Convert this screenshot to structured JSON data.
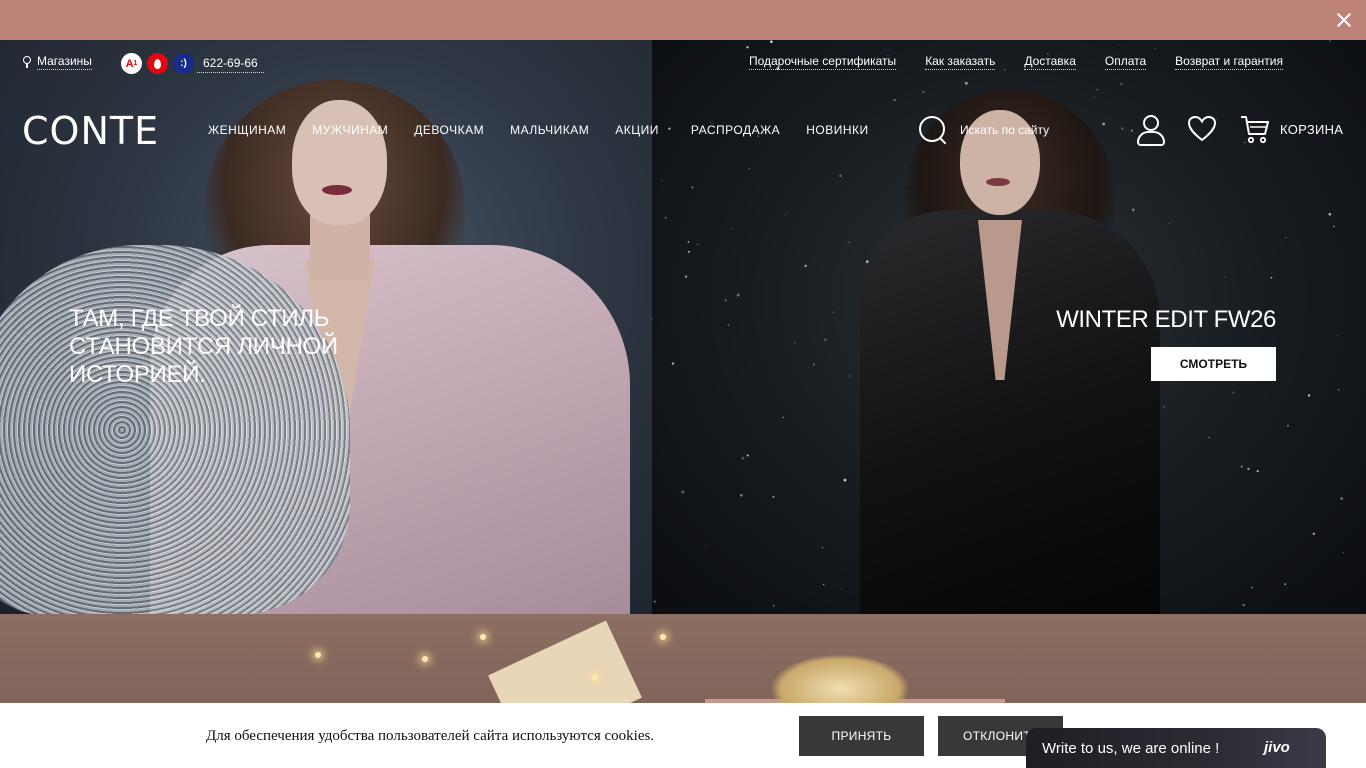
{
  "promo": {
    "close_icon": "close-icon"
  },
  "header": {
    "stores_label": "Магазины",
    "operators": [
      "A1",
      "MTS",
      "life"
    ],
    "phone": "622-69-66",
    "util_links": [
      "Подарочные сертификаты",
      "Как заказать",
      "Доставка",
      "Оплата",
      "Возврат и гарантия"
    ],
    "logo": "CONTE",
    "nav": [
      "ЖЕНЩИНАМ",
      "МУЖЧИНАМ",
      "ДЕВОЧКАМ",
      "МАЛЬЧИКАМ",
      "АКЦИИ",
      "РАСПРОДАЖА",
      "НОВИНКИ"
    ],
    "search_placeholder": "Искать по сайту",
    "cart_label": "КОРЗИНА",
    "icons": [
      "pin-icon",
      "search-icon",
      "user-icon",
      "heart-icon",
      "cart-icon"
    ]
  },
  "hero": {
    "title_lines": [
      "ТАМ, ГДЕ ТВОЙ СТИЛЬ",
      "СТАНОВИТСЯ ЛИЧНОЙ",
      "ИСТОРИЕЙ."
    ],
    "edit_title": "WINTER EDIT FW26",
    "button": "СМОТРЕТЬ"
  },
  "cookie": {
    "text": "Для обеспечения удобства пользователей сайта используются cookies.",
    "accept": "ПРИНЯТЬ",
    "decline": "ОТКЛОНИТЬ"
  },
  "chat": {
    "text": "Write to us, we are online !",
    "brand": "jivo"
  },
  "colors": {
    "promo_bar": "#bd8378",
    "button_dark": "#383838",
    "chat_green": "#2fbf4c"
  }
}
